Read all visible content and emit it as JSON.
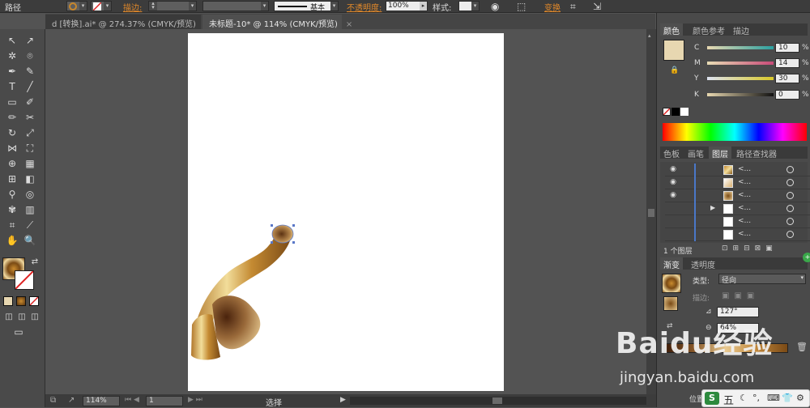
{
  "control_bar": {
    "path_label": "路径",
    "stroke_label": "描边:",
    "basic_label": "基本",
    "opacity_label": "不透明度:",
    "opacity_value": "100%",
    "style_label": "样式:",
    "transform_label": "变换"
  },
  "tabs": [
    {
      "label": "d [转换].ai* @ 274.37% (CMYK/预览)",
      "close": "×"
    },
    {
      "label": "未标题-10* @ 114% (CMYK/预览)",
      "close": "×"
    }
  ],
  "color_panel": {
    "tabs": [
      "颜色",
      "颜色参考",
      "描边"
    ],
    "channels": [
      {
        "key": "C",
        "value": "10",
        "unit": "%"
      },
      {
        "key": "M",
        "value": "14",
        "unit": "%"
      },
      {
        "key": "Y",
        "value": "30",
        "unit": "%"
      },
      {
        "key": "K",
        "value": "0",
        "unit": "%"
      }
    ],
    "swatch_color": "#e7d7b1"
  },
  "layers_panel": {
    "tabs": [
      "色板",
      "画笔",
      "图层",
      "路径查找器"
    ],
    "rows": [
      {
        "name": "<...",
        "visible": true
      },
      {
        "name": "<...",
        "visible": true
      },
      {
        "name": "<...",
        "visible": true
      },
      {
        "name": "<...",
        "visible": false
      },
      {
        "name": "<...",
        "visible": false
      },
      {
        "name": "<...",
        "visible": false
      }
    ],
    "footer": "1 个图层"
  },
  "gradient_panel": {
    "tabs": [
      "渐变",
      "透明度"
    ],
    "type_label": "类型:",
    "type_value": "径向",
    "stroke_label": "描边:",
    "angle_value": "127°",
    "ratio_value": "64%",
    "position_label": "位置"
  },
  "status_bar": {
    "zoom": "114%",
    "page": "1",
    "tool": "选择"
  },
  "watermark": {
    "line1": "Baidu经验",
    "line2": "jingyan.baidu.com"
  },
  "ime": {
    "logo": "S",
    "mode": "五"
  },
  "colors": {
    "accent_orange": "#e0882a",
    "layer_line": "#4a78c8"
  }
}
